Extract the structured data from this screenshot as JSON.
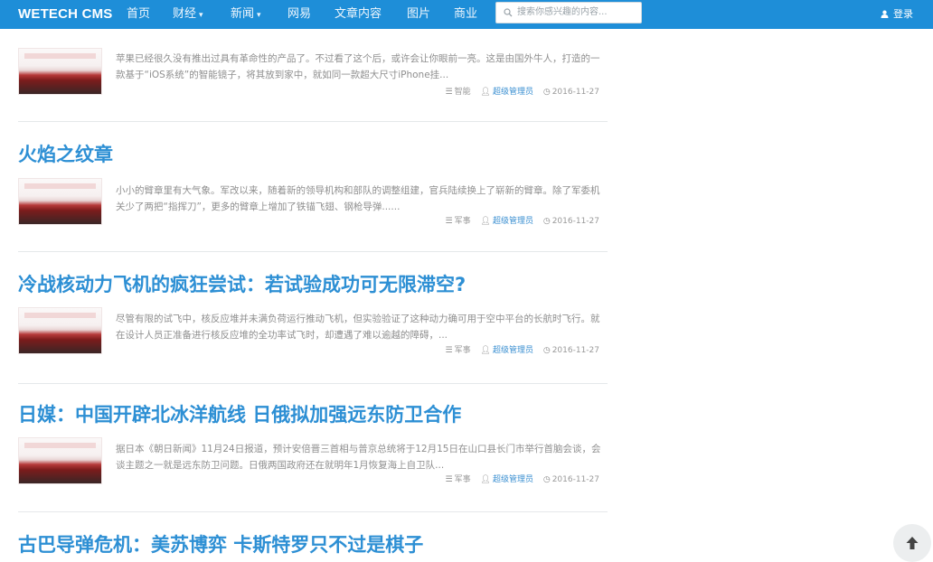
{
  "nav": {
    "brand": "WETECH CMS",
    "items": [
      {
        "label": "首页",
        "dropdown": false
      },
      {
        "label": "财经",
        "dropdown": true
      },
      {
        "label": "新闻",
        "dropdown": true
      },
      {
        "label": "网易",
        "dropdown": false
      },
      {
        "label": "文章内容",
        "dropdown": false
      },
      {
        "label": "图片",
        "dropdown": false
      },
      {
        "label": "商业",
        "dropdown": false
      }
    ],
    "caret": "▾",
    "search_placeholder": "搜索你感兴趣的内容...",
    "search_icon": "search-icon",
    "login_label": "登录",
    "login_icon": "user-icon"
  },
  "articles": [
    {
      "title": "",
      "excerpt": "苹果已经很久没有推出过具有革命性的产品了。不过看了这个后，或许会让你眼前一亮。这是由国外牛人，打造的一款基于“iOS系统”的智能镜子，将其放到家中，就如同一款超大尺寸iPhone挂...",
      "category": "智能",
      "author": "超级管理员",
      "date": "2016-11-27"
    },
    {
      "title": "火焰之纹章",
      "excerpt": "小小的臂章里有大气象。军改以来，随着新的领导机构和部队的调整组建，官兵陆续换上了崭新的臂章。除了军委机关少了两把“指挥刀”，更多的臂章上增加了铁锚飞翅、钢枪导弹......",
      "category": "军事",
      "author": "超级管理员",
      "date": "2016-11-27"
    },
    {
      "title": "冷战核动力飞机的疯狂尝试：若试验成功可无限滞空?",
      "excerpt": "尽管有限的试飞中，核反应堆并未满负荷运行推动飞机，但实验验证了这种动力确可用于空中平台的长航时飞行。就在设计人员正准备进行核反应堆的全功率试飞时，却遭遇了难以逾越的障碍，...",
      "category": "军事",
      "author": "超级管理员",
      "date": "2016-11-27"
    },
    {
      "title": "日媒：中国开辟北冰洋航线 日俄拟加强远东防卫合作",
      "excerpt": "据日本《朝日新闻》11月24日报道，预计安倍晋三首相与普京总统将于12月15日在山口县长门市举行首脑会谈，会谈主题之一就是远东防卫问题。日俄两国政府还在就明年1月恢复海上自卫队...",
      "category": "军事",
      "author": "超级管理员",
      "date": "2016-11-27"
    },
    {
      "title": "古巴导弹危机：美苏博弈 卡斯特罗只不过是棋子",
      "excerpt": "",
      "category": "",
      "author": "",
      "date": ""
    }
  ],
  "meta_icons": {
    "category": "list-icon",
    "author": "user-icon",
    "date": "clock-icon"
  },
  "back_to_top": {
    "icon": "arrow-up-icon",
    "glyph": "🡑"
  },
  "colors": {
    "navbar": "#1e8ed8",
    "title": "#2d8fd4",
    "author_link": "#3a8fd1"
  }
}
